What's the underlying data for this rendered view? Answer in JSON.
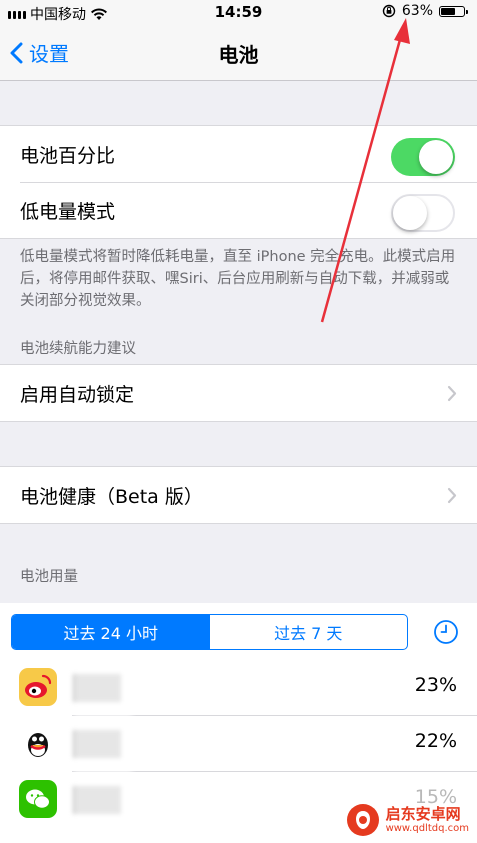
{
  "status_bar": {
    "carrier": "中国移动",
    "time": "14:59",
    "battery_percent": "63%",
    "battery_level": 0.63
  },
  "nav": {
    "back_label": "设置",
    "title": "电池"
  },
  "toggles": {
    "battery_percentage_label": "电池百分比",
    "battery_percentage_on": true,
    "low_power_label": "低电量模式",
    "low_power_on": false
  },
  "low_power_note": "低电量模式将暂时降低耗电量，直至 iPhone 完全充电。此模式启用后，将停用邮件获取、嘿Siri、后台应用刷新与自动下载，并减弱或关闭部分视觉效果。",
  "suggestions": {
    "header": "电池续航能力建议",
    "auto_lock_label": "启用自动锁定"
  },
  "health": {
    "label": "电池健康（Beta 版）"
  },
  "usage": {
    "header": "电池用量",
    "segments": [
      "过去 24 小时",
      "过去 7 天"
    ],
    "selected_segment": 0,
    "apps": [
      {
        "icon": "weibo-icon",
        "percent": "23%"
      },
      {
        "icon": "qq-icon",
        "percent": "22%"
      },
      {
        "icon": "wechat-icon",
        "percent": "15%"
      }
    ]
  },
  "watermark": {
    "name": "启东安卓网",
    "url": "www.qdltdq.com"
  },
  "colors": {
    "accent": "#007aff",
    "toggle_on": "#4cd964",
    "annotation_arrow": "#e8303a"
  }
}
